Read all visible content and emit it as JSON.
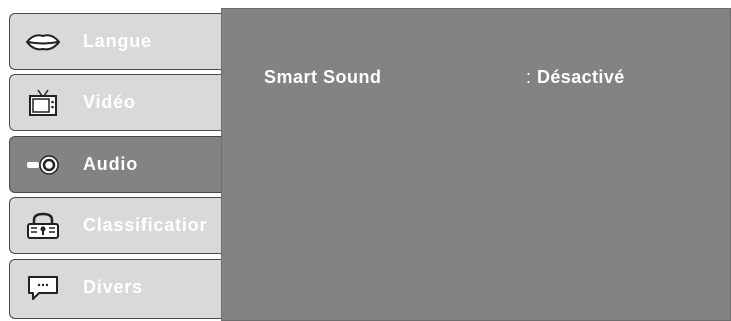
{
  "menu": {
    "items": [
      {
        "label": "Langue",
        "icon": "lips-icon",
        "active": false
      },
      {
        "label": "Vidéo",
        "icon": "tv-icon",
        "active": false
      },
      {
        "label": "Audio",
        "icon": "speaker-icon",
        "active": true
      },
      {
        "label": "Classificatior",
        "icon": "padlock-icon",
        "active": false
      },
      {
        "label": "Divers",
        "icon": "speech-bubble-icon",
        "active": false
      }
    ]
  },
  "audio_settings": {
    "rows": [
      {
        "label": "Smart Sound",
        "separator": ":",
        "value": "Désactivé"
      }
    ]
  },
  "colors": {
    "panel": "#838385",
    "tab_inactive": "#d9d9da",
    "text": "#ffffff"
  }
}
